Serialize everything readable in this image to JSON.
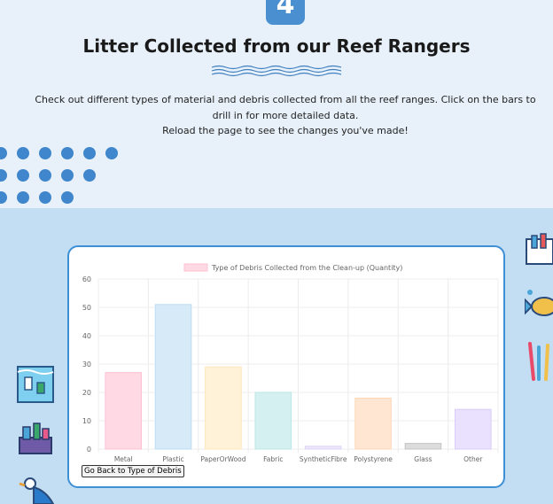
{
  "header": {
    "step_number": "4",
    "title": "Litter Collected from our Reef Rangers"
  },
  "intro": {
    "line1": "Check out different types of material and debris collected from all the reef ranges. Click on the bars to drill in for more detailed data.",
    "line2": "Reload the page to see the changes you've made!"
  },
  "chart": {
    "back_button_label": "Go Back to Type of Debris"
  },
  "chart_data": {
    "type": "bar",
    "legend": "Type of Debris Collected from the Clean-up (Quantity)",
    "legend_position": "top",
    "categories": [
      "Metal",
      "Plastic",
      "PaperOrWood",
      "Fabric",
      "SyntheticFibre",
      "Polystyrene",
      "Glass",
      "Other"
    ],
    "values": [
      27,
      51,
      29,
      20,
      1,
      18,
      2,
      14
    ],
    "ylim": [
      0,
      60
    ],
    "yticks": [
      0,
      10,
      20,
      30,
      40,
      50,
      60
    ],
    "grid": true,
    "bar_colors": [
      "#ffd9e4",
      "#d6eaf8",
      "#fff2d9",
      "#d5f0f0",
      "#ece7fa",
      "#ffe6d2",
      "#dcdcdc",
      "#e9e1fd"
    ],
    "bar_borders": [
      "#ffc2d3",
      "#bcdcf4",
      "#ffe5b8",
      "#bce6e6",
      "#ddd3f7",
      "#ffd7b8",
      "#c4c4c4",
      "#d9cbfa"
    ]
  },
  "colors": {
    "page_background": "#e8f1fa",
    "lower_band": "#c3ddf3",
    "accent_blue": "#3d8fd6",
    "dots": "#3f86cc"
  }
}
